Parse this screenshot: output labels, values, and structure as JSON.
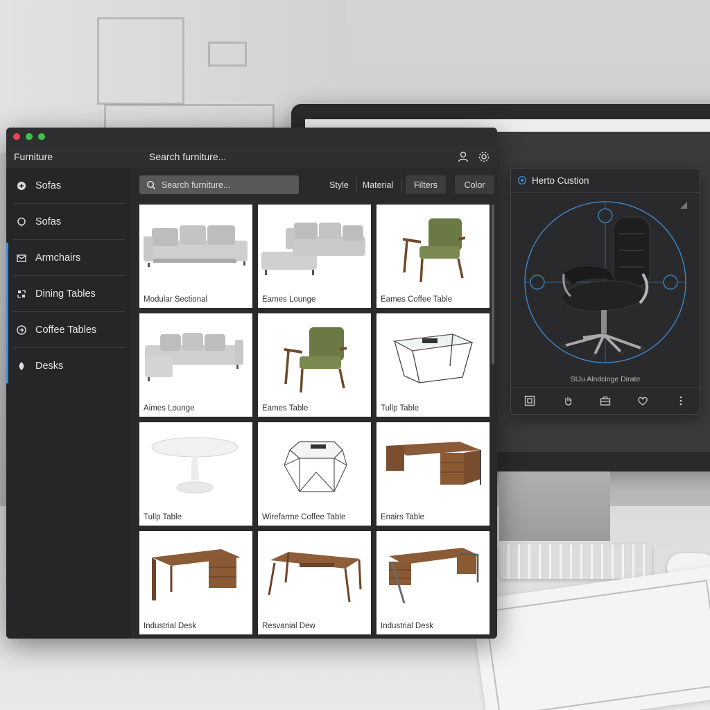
{
  "window": {
    "title": "Furniture",
    "header_search": "Search furniture..."
  },
  "sidebar": {
    "items": [
      {
        "label": "Sofas",
        "icon": "sofa-icon"
      },
      {
        "label": "Sofas",
        "icon": "sofa-outline-icon"
      },
      {
        "label": "Armchairs",
        "icon": "armchair-icon"
      },
      {
        "label": "Dining Tables",
        "icon": "dining-table-icon"
      },
      {
        "label": "Coffee Tables",
        "icon": "coffee-table-icon"
      },
      {
        "label": "Desks",
        "icon": "desk-icon"
      }
    ]
  },
  "toolbar": {
    "search_placeholder": "Search furniture...",
    "style_label": "Style",
    "material_label": "Material",
    "filters_label": "Filters",
    "color_label": "Color"
  },
  "grid": {
    "items": [
      {
        "label": "Modular Sectional",
        "kind": "sofa-long"
      },
      {
        "label": "Eames Lounge",
        "kind": "sofa-chaise"
      },
      {
        "label": "Eames Coffee Table",
        "kind": "armchair"
      },
      {
        "label": "Aimes Lounge",
        "kind": "sofa-chaise-2"
      },
      {
        "label": "Eames Table",
        "kind": "armchair"
      },
      {
        "label": "Tullp Table",
        "kind": "glass-table"
      },
      {
        "label": "Tullp Table",
        "kind": "tulip-table"
      },
      {
        "label": "Wirefarme Coffee Table",
        "kind": "wire-table"
      },
      {
        "label": "Enairs Table",
        "kind": "desk"
      },
      {
        "label": "Industrial Desk",
        "kind": "desk"
      },
      {
        "label": "Resvanial Dew",
        "kind": "bench-desk"
      },
      {
        "label": "Industrial Desk",
        "kind": "desk-metal"
      }
    ]
  },
  "preview": {
    "title": "Herto Custion",
    "caption": "StJu Alndcinge Dirate"
  },
  "colors": {
    "accent": "#3e8ed8",
    "window_bg": "#2b2b2d",
    "dot_red": "#e5484d",
    "dot_yellow": "#3fbf4a",
    "dot_green": "#3fbf4a"
  }
}
